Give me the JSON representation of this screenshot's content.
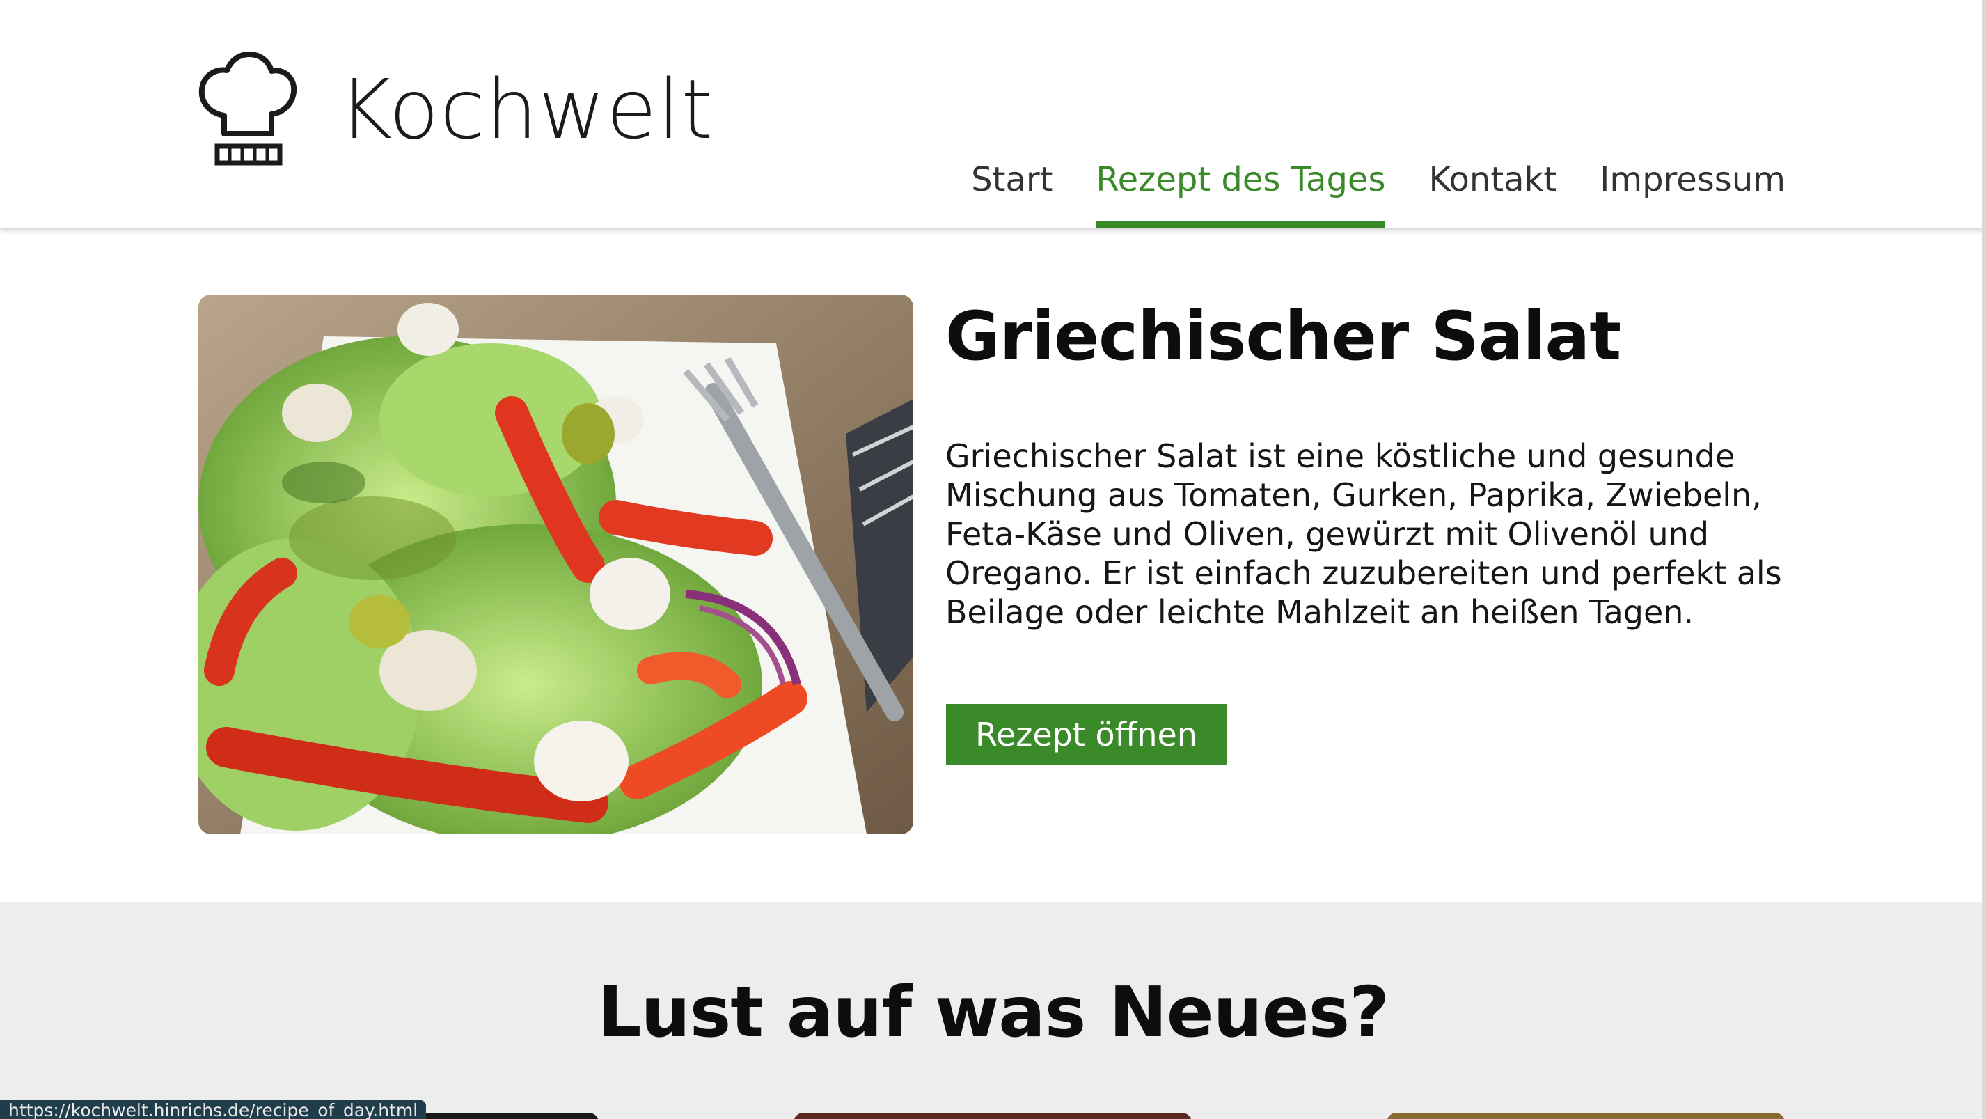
{
  "brand": {
    "name": "Kochwelt",
    "icon": "chef-hat-icon"
  },
  "nav": {
    "items": [
      {
        "label": "Start",
        "active": false
      },
      {
        "label": "Rezept des Tages",
        "active": true
      },
      {
        "label": "Kontakt",
        "active": false
      },
      {
        "label": "Impressum",
        "active": false
      }
    ]
  },
  "recipe": {
    "image_alt": "greek-salad-photo",
    "title": "Griechischer Salat",
    "description": "Griechischer Salat ist eine köstliche und gesunde Mischung aus Tomaten, Gurken, Paprika, Zwiebeln, Feta-Käse und Oliven, gewürzt mit Olivenöl und Oregano. Er ist einfach zuzubereiten und perfekt als Beilage oder leichte Mahlzeit an heißen Tagen.",
    "button_label": "Rezept öffnen"
  },
  "discover": {
    "title": "Lust auf was Neues?"
  },
  "status_bar": {
    "url": "https://kochwelt.hinrichs.de/recipe_of_day.html"
  },
  "colors": {
    "accent": "#3a8a2a",
    "section_bg": "#ededed",
    "status_bg": "#1f3d4a"
  }
}
